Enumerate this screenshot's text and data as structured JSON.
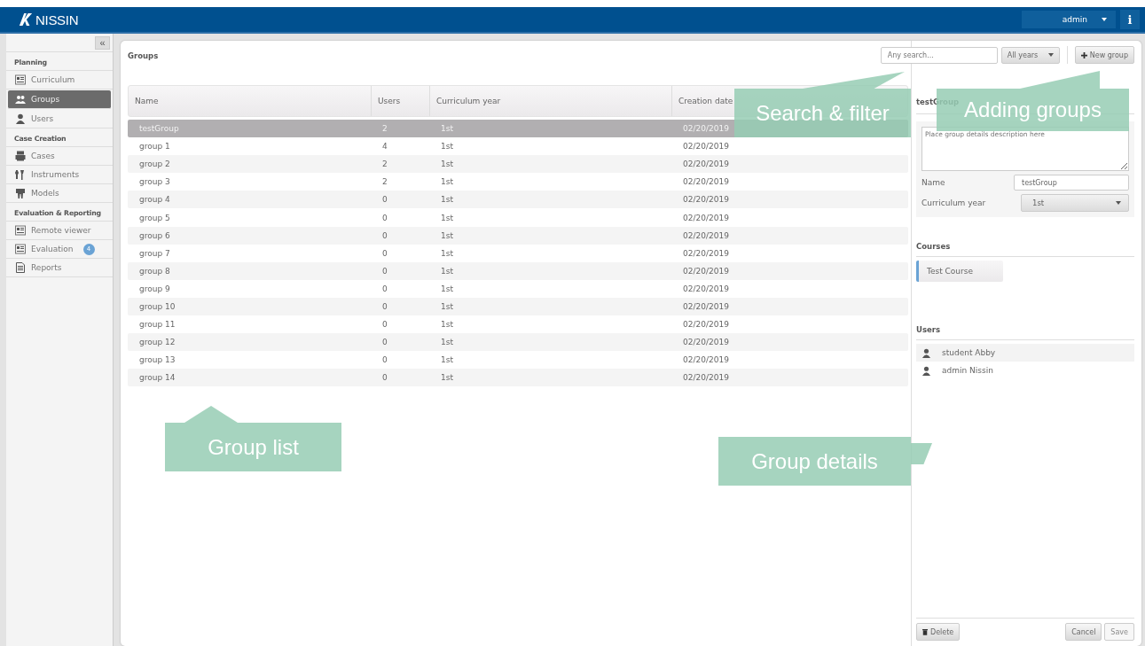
{
  "header": {
    "logo": "NISSIN",
    "user_menu": "admin",
    "info_button": "i"
  },
  "sidebar": {
    "collapse": "«",
    "sections": [
      {
        "title": "Planning",
        "items": [
          {
            "label": "Curriculum",
            "kind": "board",
            "selected": false
          },
          {
            "label": "Groups",
            "kind": "group",
            "selected": true
          },
          {
            "label": "Users",
            "kind": "user",
            "selected": false
          }
        ]
      },
      {
        "title": "Case Creation",
        "items": [
          {
            "label": "Cases",
            "kind": "case",
            "selected": false
          },
          {
            "label": "Instruments",
            "kind": "tool",
            "selected": false
          },
          {
            "label": "Models",
            "kind": "tooth",
            "selected": false
          }
        ]
      },
      {
        "title": "Evaluation & Reporting",
        "items": [
          {
            "label": "Remote viewer",
            "kind": "board",
            "selected": false
          },
          {
            "label": "Evaluation",
            "kind": "board",
            "selected": false,
            "badge": "4"
          },
          {
            "label": "Reports",
            "kind": "doc",
            "selected": false
          }
        ]
      }
    ]
  },
  "page": {
    "title": "Groups",
    "search": {
      "placeholder": "Any search..."
    },
    "year_filter": "All years",
    "new_button": "New group"
  },
  "table": {
    "columns": [
      "Name",
      "Users",
      "Curriculum year",
      "Creation date"
    ],
    "rows": [
      {
        "cells": [
          "testGroup",
          "2",
          "1st",
          "02/20/2019"
        ],
        "selected": true
      },
      {
        "cells": [
          "group 1",
          "4",
          "1st",
          "02/20/2019"
        ],
        "selected": false
      },
      {
        "cells": [
          "group 2",
          "2",
          "1st",
          "02/20/2019"
        ],
        "selected": false
      },
      {
        "cells": [
          "group 3",
          "2",
          "1st",
          "02/20/2019"
        ],
        "selected": false
      },
      {
        "cells": [
          "group 4",
          "0",
          "1st",
          "02/20/2019"
        ],
        "selected": false
      },
      {
        "cells": [
          "group 5",
          "0",
          "1st",
          "02/20/2019"
        ],
        "selected": false
      },
      {
        "cells": [
          "group 6",
          "0",
          "1st",
          "02/20/2019"
        ],
        "selected": false
      },
      {
        "cells": [
          "group 7",
          "0",
          "1st",
          "02/20/2019"
        ],
        "selected": false
      },
      {
        "cells": [
          "group 8",
          "0",
          "1st",
          "02/20/2019"
        ],
        "selected": false
      },
      {
        "cells": [
          "group 9",
          "0",
          "1st",
          "02/20/2019"
        ],
        "selected": false
      },
      {
        "cells": [
          "group 10",
          "0",
          "1st",
          "02/20/2019"
        ],
        "selected": false
      },
      {
        "cells": [
          "group 11",
          "0",
          "1st",
          "02/20/2019"
        ],
        "selected": false
      },
      {
        "cells": [
          "group 12",
          "0",
          "1st",
          "02/20/2019"
        ],
        "selected": false
      },
      {
        "cells": [
          "group 13",
          "0",
          "1st",
          "02/20/2019"
        ],
        "selected": false
      },
      {
        "cells": [
          "group 14",
          "0",
          "1st",
          "02/20/2019"
        ],
        "selected": false
      }
    ]
  },
  "details": {
    "title": "testGroup",
    "description": {
      "placeholder": "Place group details description here"
    },
    "name_label": "Name",
    "name_value": "testGroup",
    "year_label": "Curriculum year",
    "year_value": "1st",
    "courses_title": "Courses",
    "courses": [
      "Test Course"
    ],
    "users_title": "Users",
    "users": [
      "student Abby",
      "admin Nissin"
    ],
    "delete_button": "Delete",
    "cancel_button": "Cancel",
    "save_button": "Save",
    "save_disabled": true
  },
  "callouts": [
    {
      "kind": "search",
      "text": "Search & filter"
    },
    {
      "kind": "add",
      "text": "Adding groups"
    },
    {
      "kind": "list",
      "text": "Group list"
    },
    {
      "kind": "details",
      "text": "Group details"
    }
  ]
}
